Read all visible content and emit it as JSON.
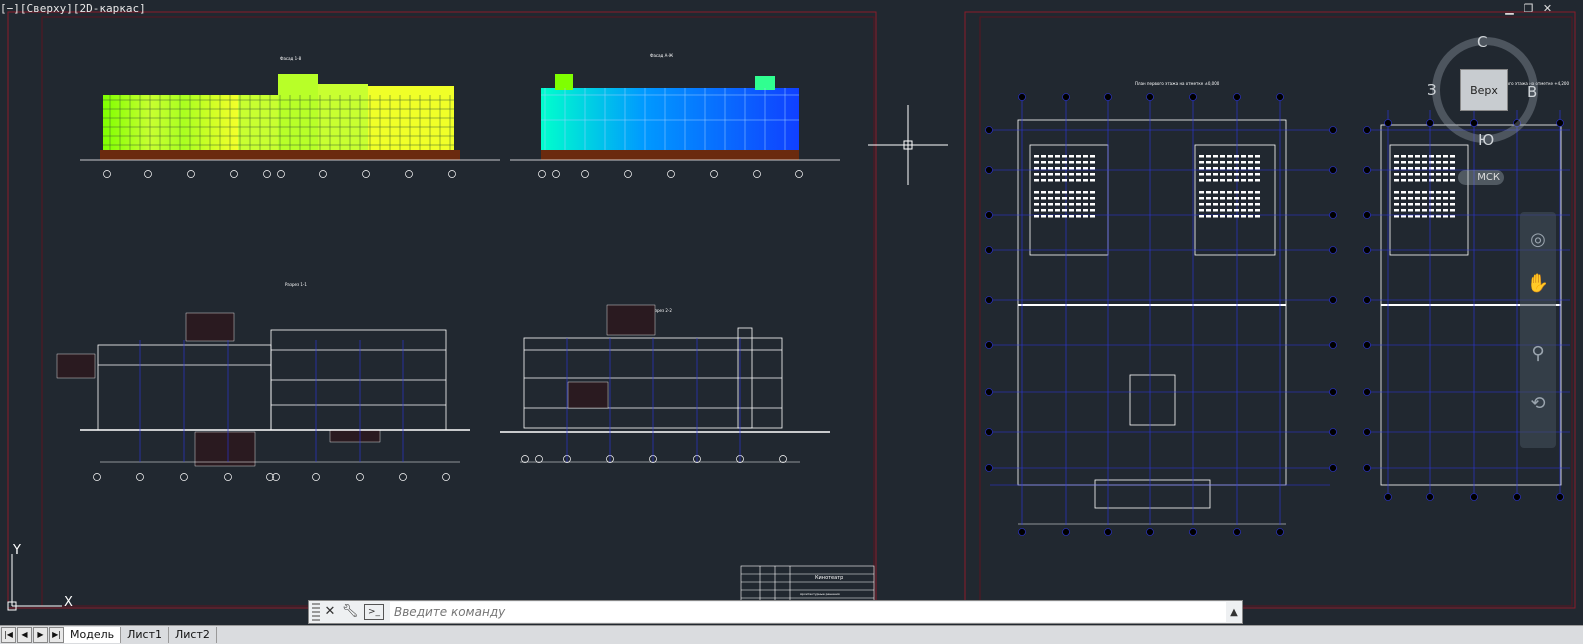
{
  "viewport": {
    "label_parts": [
      "[−]",
      "[Сверху]",
      "[2D-каркас]"
    ],
    "window_controls": [
      "minimize-icon",
      "restore-icon",
      "close-icon"
    ]
  },
  "viewcube": {
    "face": "Верх",
    "north": "С",
    "south": "Ю",
    "west": "З",
    "east": "В",
    "wcs": "МСК"
  },
  "drawing_titles": {
    "facade_1": "Фасад 1-8",
    "facade_2": "Фасад А-Ж",
    "section_1": "Разрез 1-1",
    "section_2": "Разрез 2-2",
    "plan_1": "План первого этажа на отметке ±0,000",
    "plan_2": "План второго этажа на отметке +4,200",
    "stamp_title": "Кинотеатр",
    "stamp_sub": "Архитектурные решения"
  },
  "ucs": {
    "y_label": "Y",
    "x_label": "X"
  },
  "command": {
    "placeholder": "Введите команду",
    "close_icon": "close-icon",
    "settings_icon": "wrench-icon",
    "prompt_icon": "command-prompt-icon"
  },
  "tabs": [
    {
      "label": "Модель",
      "active": true
    },
    {
      "label": "Лист1",
      "active": false
    },
    {
      "label": "Лист2",
      "active": false
    }
  ],
  "colors": {
    "background": "#212830",
    "sheet_border": "#8a1c2a",
    "grid": "#2c34e6",
    "lines": "#ffffff",
    "facade_green": "#7fff00",
    "facade_yellow": "#f4ff2a",
    "facade_blue": "#1a66ff",
    "ground_brown": "#6b2a0e"
  }
}
